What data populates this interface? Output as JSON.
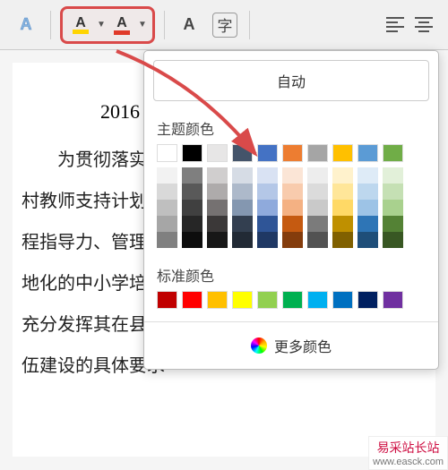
{
  "toolbar": {
    "text_outline_A": "A",
    "highlighter_A": "A",
    "font_color_A": "A",
    "plain_A": "A",
    "char_format": "字",
    "dropdown_glyph": "▼"
  },
  "doc": {
    "year_heading": "2016",
    "p1_indent": "为贯彻落实《",
    "p2": "村教师支持计划",
    "p3": "程指导力、管理者",
    "p4": "地化的中小学培讨",
    "p5": "充分发挥其在县域",
    "p6": "伍建设的具体要求"
  },
  "popup": {
    "auto_label": "自动",
    "theme_label": "主题颜色",
    "standard_label": "标准颜色",
    "more_label": "更多颜色",
    "theme_colors": [
      "#ffffff",
      "#000000",
      "#e7e6e6",
      "#44546a",
      "#4472c4",
      "#ed7d31",
      "#a5a5a5",
      "#ffc000",
      "#5b9bd5",
      "#70ad47"
    ],
    "theme_shades": [
      [
        "#f2f2f2",
        "#7f7f7f",
        "#d0cece",
        "#d6dce5",
        "#d9e2f3",
        "#fbe5d6",
        "#ededed",
        "#fff2cc",
        "#deebf7",
        "#e2f0d9"
      ],
      [
        "#d9d9d9",
        "#595959",
        "#aeabab",
        "#adb9ca",
        "#b4c7e7",
        "#f8cbad",
        "#dbdbdb",
        "#ffe699",
        "#bdd7ee",
        "#c5e0b4"
      ],
      [
        "#bfbfbf",
        "#404040",
        "#757171",
        "#8497b0",
        "#8faadc",
        "#f4b183",
        "#c9c9c9",
        "#ffd966",
        "#9dc3e6",
        "#a9d18e"
      ],
      [
        "#a6a6a6",
        "#262626",
        "#3b3838",
        "#333f50",
        "#2f5597",
        "#c55a11",
        "#7b7b7b",
        "#bf9000",
        "#2e75b6",
        "#548235"
      ],
      [
        "#808080",
        "#0d0d0d",
        "#171717",
        "#222a35",
        "#1f3864",
        "#843c0c",
        "#525252",
        "#806000",
        "#1e4e79",
        "#385723"
      ]
    ],
    "standard_colors": [
      "#c00000",
      "#ff0000",
      "#ffc000",
      "#ffff00",
      "#92d050",
      "#00b050",
      "#00b0f0",
      "#0070c0",
      "#002060",
      "#7030a0"
    ]
  },
  "watermark": {
    "cn": "易采站长站",
    "en": "www.easck.com"
  }
}
